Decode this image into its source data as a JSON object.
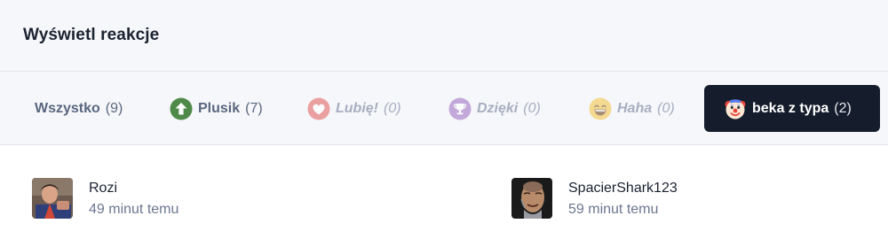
{
  "dialog": {
    "title": "Wyświetl reakcje"
  },
  "tabs": [
    {
      "label": "Wszystko",
      "count": "(9)"
    },
    {
      "label": "Plusik",
      "count": "(7)",
      "icon": "arrow-up-icon"
    },
    {
      "label": "Lubię!",
      "count": "(0)",
      "icon": "heart-icon"
    },
    {
      "label": "Dzięki",
      "count": "(0)",
      "icon": "trophy-icon"
    },
    {
      "label": "Haha",
      "count": "(0)",
      "icon": "laughing-face-icon"
    },
    {
      "label": "beka z typa",
      "count": "(2)",
      "icon": "clown-face-icon",
      "selected": true
    }
  ],
  "users": [
    {
      "name": "Rozi",
      "time": "49 minut temu",
      "avatar": "avatar-photo"
    },
    {
      "name": "SpacierShark123",
      "time": "59 minut temu",
      "avatar": "avatar-photo"
    }
  ],
  "colors": {
    "active_tab_bg": "#151c2c",
    "plusik_green": "#4f8a4a",
    "heart_red": "#e25a5a",
    "trophy_purple": "#9b6ac1",
    "muted_text": "#6b7790"
  }
}
